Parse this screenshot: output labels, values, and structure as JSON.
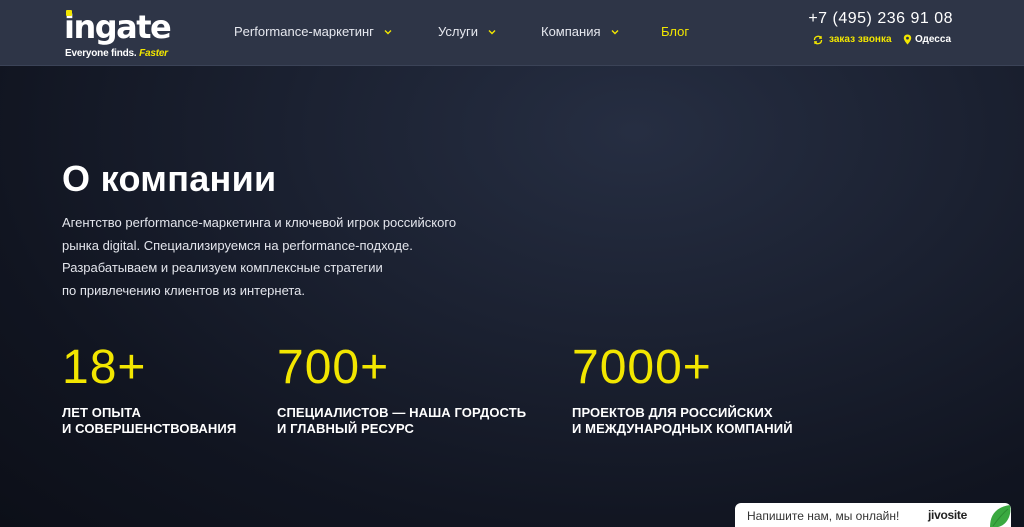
{
  "header": {
    "logo": {
      "word": "ingate",
      "tagline": "Everyone finds.",
      "tagline_accent": "Faster"
    },
    "nav": [
      {
        "label": "Performance-маркетинг",
        "has_dropdown": true
      },
      {
        "label": "Услуги",
        "has_dropdown": true
      },
      {
        "label": "Компания",
        "has_dropdown": true
      },
      {
        "label": "Блог",
        "has_dropdown": false
      }
    ],
    "phone": "+7 (495) 236 91 08",
    "callback_label": "заказ звонка",
    "city": "Одесса"
  },
  "hero": {
    "title": "О компании",
    "description_lines": [
      "Агентство performance-маркетинга и ключевой игрок российского",
      "рынка digital. Специализируемся на performance-подходе.",
      "Разрабатываем и реализуем комплексные стратегии",
      "по привлечению клиентов из интернета."
    ]
  },
  "stats": [
    {
      "number": "18+",
      "label_lines": [
        "ЛЕТ ОПЫТА",
        "И СОВЕРШЕНСТВОВАНИЯ"
      ]
    },
    {
      "number": "700+",
      "label_lines": [
        "СПЕЦИАЛИСТОВ — НАША ГОРДОСТЬ",
        "И ГЛАВНЫЙ РЕСУРС"
      ]
    },
    {
      "number": "7000+",
      "label_lines": [
        "ПРОЕКТОВ ДЛЯ РОССИЙСКИХ",
        "И МЕЖДУНАРОДНЫХ КОМПАНИЙ"
      ]
    }
  ],
  "chat_widget": {
    "text": "Напишите нам, мы онлайн!",
    "brand": "jivosite"
  },
  "colors": {
    "accent": "#f2e600",
    "header_bg": "#2e3547",
    "page_bg": "#141926"
  },
  "icons": {
    "nav_dropdown": "chevron-down-icon",
    "callback": "refresh-arrows-icon",
    "city": "location-pin-icon",
    "chat": "leaf-icon"
  }
}
